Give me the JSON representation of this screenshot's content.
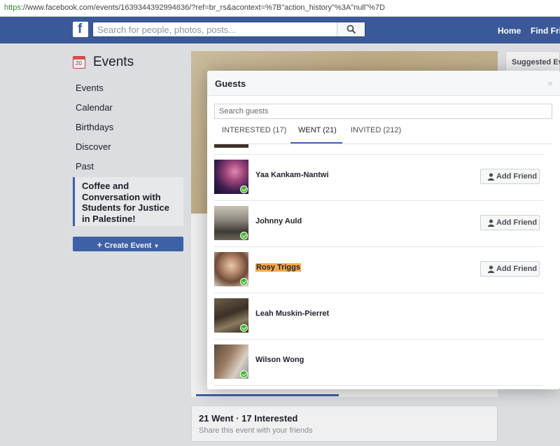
{
  "browser": {
    "url": "https://www.facebook.com/events/1639344392994636/?ref=br_rs&acontext=%7B\"action_history\"%3A\"null\"%7D"
  },
  "header": {
    "logo_letter": "f",
    "search_placeholder": "Search for people, photos, posts...",
    "nav": {
      "home": "Home",
      "find_friends": "Find Frie"
    },
    "brand_color": "#3b5998"
  },
  "sidebar": {
    "calendar_day": "20",
    "title": "Events",
    "items": [
      {
        "label": "Events"
      },
      {
        "label": "Calendar"
      },
      {
        "label": "Birthdays"
      },
      {
        "label": "Discover"
      },
      {
        "label": "Past"
      }
    ],
    "selected_event": "Coffee and Conversation with Students for Justice in Palestine!",
    "create_button": "Create Event"
  },
  "right_column": {
    "suggested": "Suggested Eve"
  },
  "event": {
    "stats": "21 Went · 17 Interested",
    "share_text": "Share this event with your friends"
  },
  "modal": {
    "title": "Guests",
    "close": "×",
    "search_placeholder": "Search guests",
    "tabs": [
      {
        "label": "INTERESTED (17)"
      },
      {
        "label": "WENT (21)"
      },
      {
        "label": "INVITED (212)"
      }
    ],
    "active_tab": "WENT (21)",
    "add_friend_label": "Add Friend",
    "guests": [
      {
        "name": "Yaa Kankam-Nantwi",
        "went": true,
        "add_friend": true
      },
      {
        "name": "Johnny Auld",
        "went": true,
        "add_friend": true
      },
      {
        "name": "Rosy Triggs",
        "went": true,
        "add_friend": true,
        "highlighted": true
      },
      {
        "name": "Leah Muskin-Pierret",
        "went": true,
        "add_friend": false
      },
      {
        "name": "Wilson Wong",
        "went": true,
        "add_friend": false
      }
    ]
  }
}
